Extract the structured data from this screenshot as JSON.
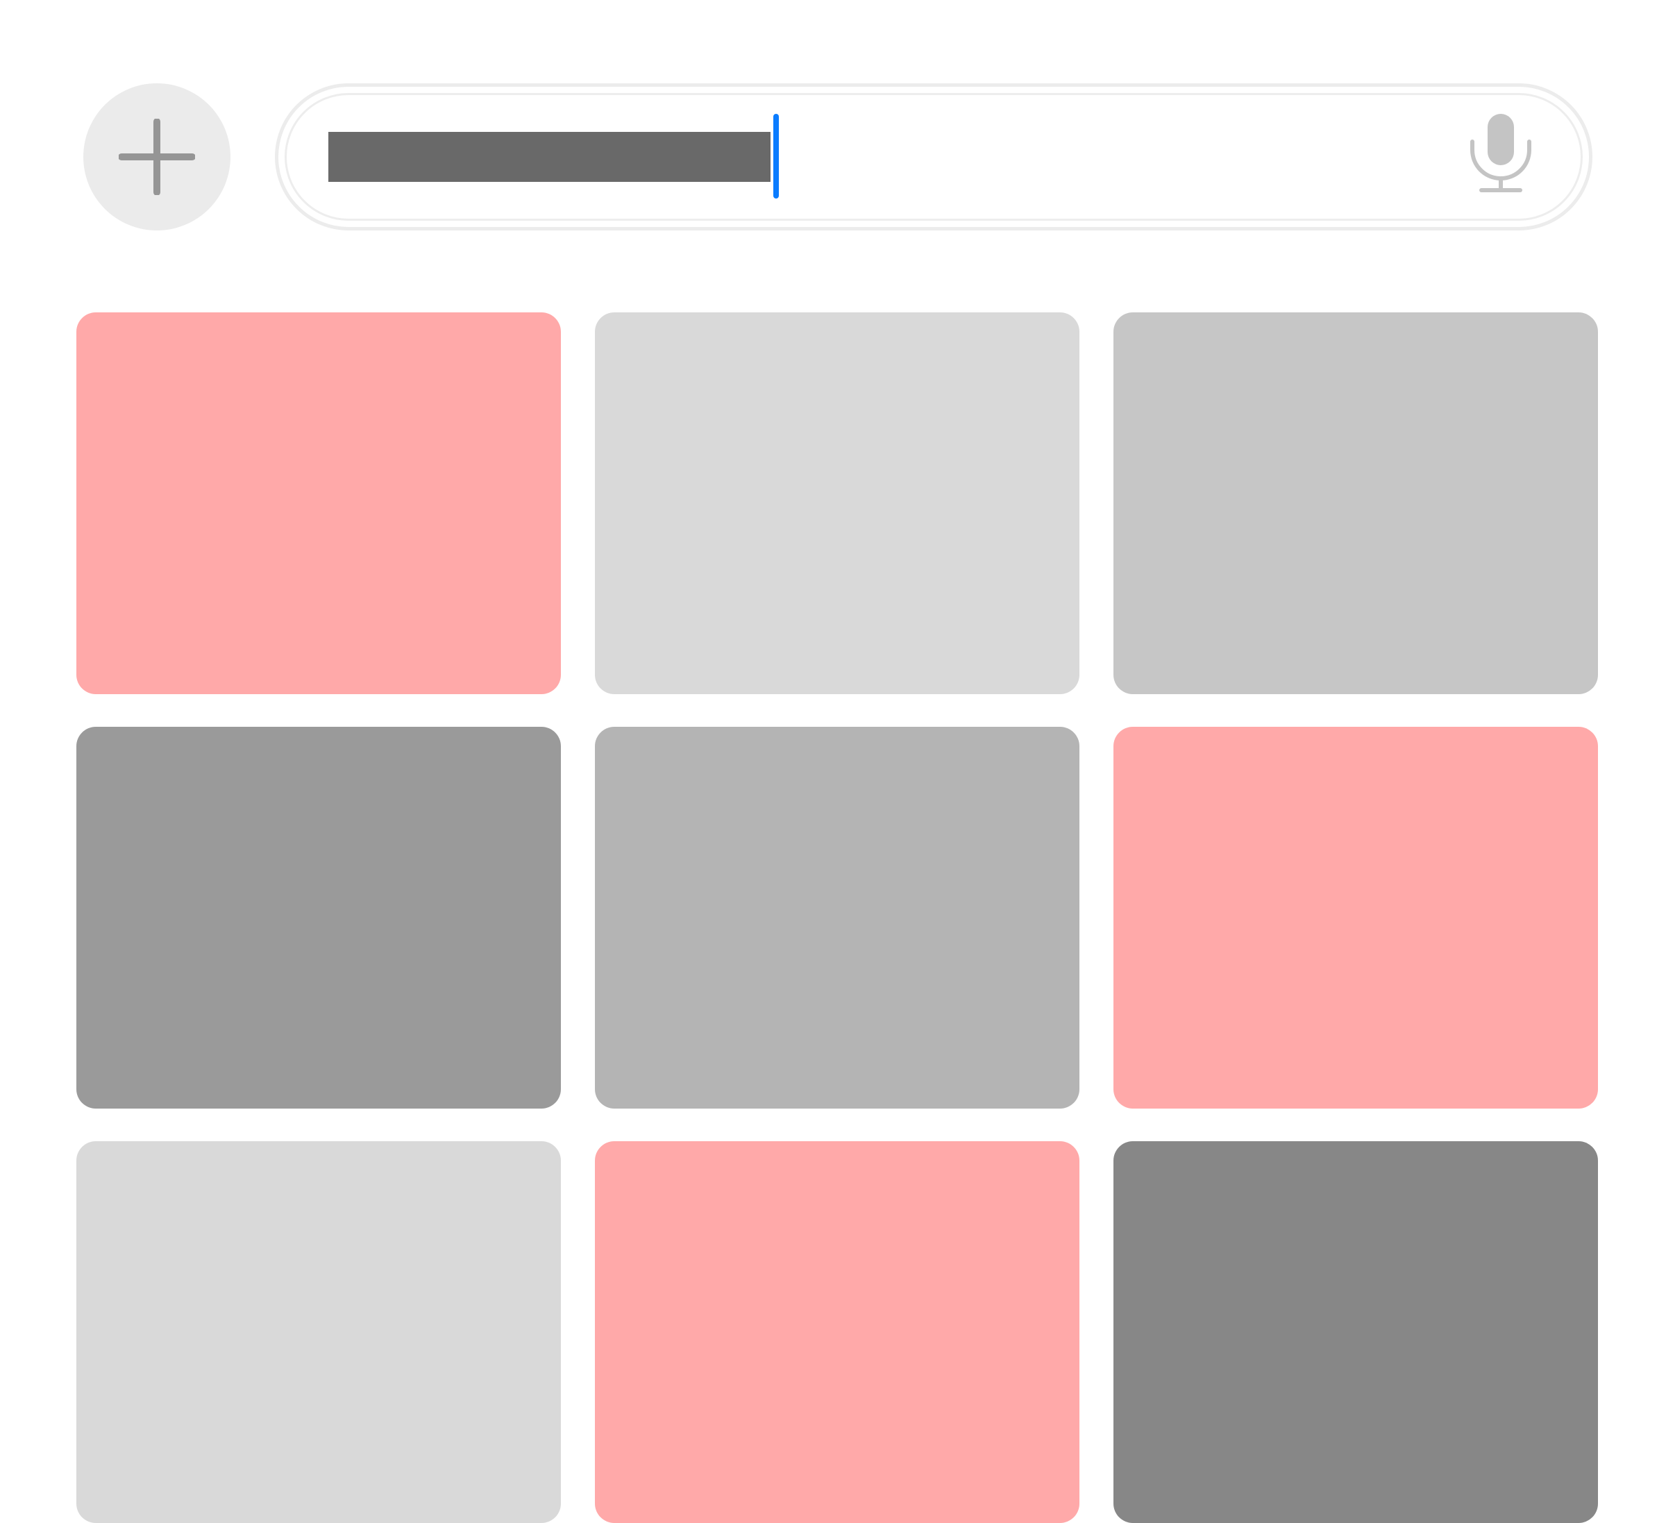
{
  "toolbar": {
    "add_button": {
      "icon": "plus-icon",
      "background": "#ebebeb",
      "icon_color": "#959595"
    }
  },
  "search": {
    "value": "",
    "placeholder": "",
    "selection_color": "#696969",
    "caret_color": "#0a7cff",
    "mic_icon": "microphone-icon",
    "mic_color": "#c4c4c4"
  },
  "tiles": [
    {
      "color": "#ffa9a9"
    },
    {
      "color": "#d9d9d9"
    },
    {
      "color": "#c6c6c6"
    },
    {
      "color": "#9a9a9a"
    },
    {
      "color": "#b4b4b4"
    },
    {
      "color": "#ffa9a9"
    },
    {
      "color": "#d9d9d9"
    },
    {
      "color": "#ffa9a9"
    },
    {
      "color": "#878787"
    }
  ]
}
